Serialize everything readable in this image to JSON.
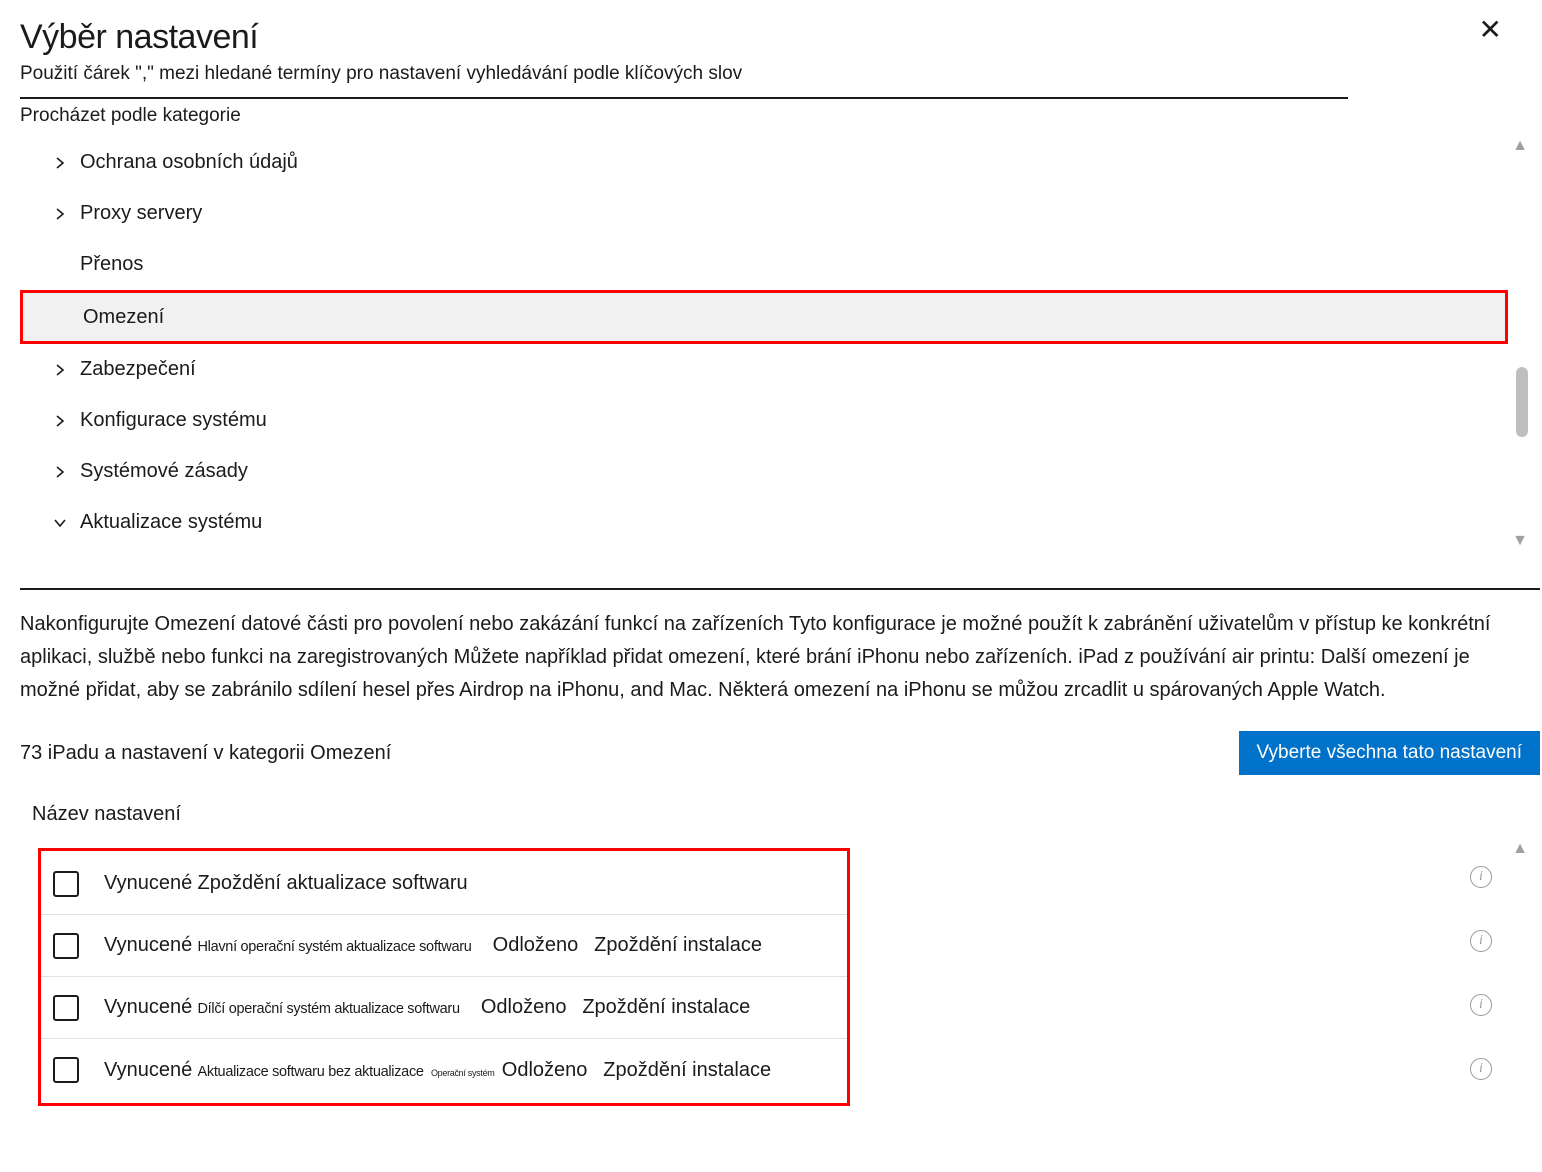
{
  "header": {
    "title": "Výběr nastavení",
    "subtitle": "Použití čárek   \",\"  mezi hledané termíny pro nastavení vyhledávání podle klíčových slov",
    "close_label": "✕"
  },
  "browse_label": "Procházet podle kategorie",
  "categories": [
    {
      "label": "Ochrana osobních údajů",
      "chevron": "right"
    },
    {
      "label": "Proxy servery",
      "chevron": "right"
    },
    {
      "label": "Přenos",
      "chevron": "none"
    },
    {
      "label": "Omezení",
      "chevron": "none",
      "selected": true
    },
    {
      "label": "Zabezpečení",
      "chevron": "right"
    },
    {
      "label": "Konfigurace systému",
      "chevron": "right"
    },
    {
      "label": "Systémové zásady",
      "chevron": "right"
    },
    {
      "label": "Aktualizace systému",
      "chevron": "down"
    }
  ],
  "description": "Nakonfigurujte   Omezení datové části pro povolení nebo zakázání funkcí na zařízeních Tyto konfigurace je možné použít k zabránění uživatelům v přístup ke konkrétní aplikaci, službě nebo funkci na zaregistrovaných           Můžete například přidat omezení, které brání iPhonu nebo zařízeních. iPad z používání air printu: Další omezení je možné přidat, aby se zabránilo sdílení hesel přes Airdrop na iPhonu, and   Mac. Některá omezení na iPhonu se můžou zrcadlit u spárovaných Apple Watch.",
  "count_text": "73 iPadu a nastavení v kategorii Omezení",
  "select_all_label": "Vyberte všechna tato nastavení",
  "settings_header": "Název nastavení",
  "settings": [
    {
      "p1": "Vynucené",
      "p2": "Zpoždění aktualizace softwaru",
      "p3": "",
      "p4": "",
      "p5": ""
    },
    {
      "p1": "Vynucené",
      "p2": "Hlavní operační systém aktualizace softwaru",
      "p3": "",
      "p4": "Odloženo",
      "p5": "Zpoždění instalace"
    },
    {
      "p1": "Vynucené",
      "p2": "Dílčí operační systém aktualizace softwaru",
      "p3": "",
      "p4": "Odloženo",
      "p5": "Zpoždění instalace"
    },
    {
      "p1": "Vynucené",
      "p2": "Aktualizace softwaru bez aktualizace",
      "p3": "Operační systém",
      "p4": "Odloženo",
      "p5": "Zpoždění instalace"
    }
  ],
  "info_glyph": "i"
}
